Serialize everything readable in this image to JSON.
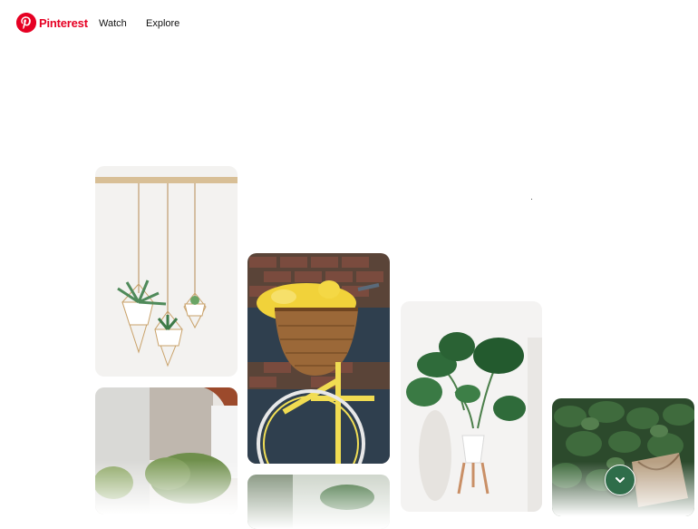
{
  "brand": {
    "name": "Pinterest",
    "color": "#e60023"
  },
  "nav": {
    "watch": "Watch",
    "explore": "Explore"
  },
  "pins": [
    {
      "subject": "hanging-geometric-planters"
    },
    {
      "subject": "yellow-bicycle-tulip-basket"
    },
    {
      "subject": "monstera-plant-stand"
    },
    {
      "subject": "woman-with-greens"
    },
    {
      "subject": "green-leaves-basket"
    },
    {
      "subject": "plant-faded"
    }
  ],
  "scroll_button": {
    "icon": "chevron-down-icon",
    "color": "#2f6d4a"
  }
}
